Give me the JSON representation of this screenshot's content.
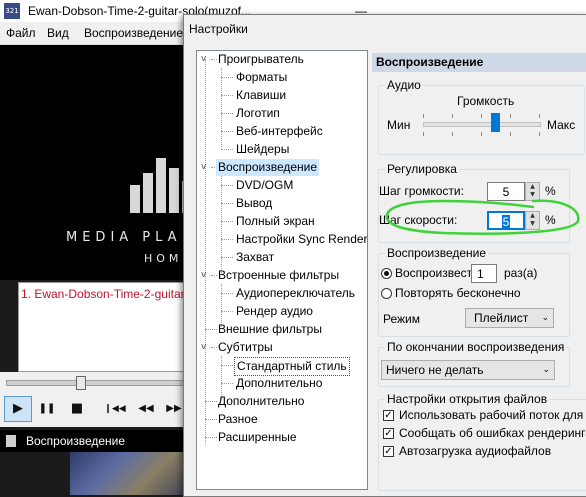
{
  "player": {
    "icon_label": "321",
    "title": "Ewan-Dobson-Time-2-guitar-solo(muzof...",
    "minimize_glyph": "—",
    "menu": [
      "Файл",
      "Вид",
      "Воспроизведение"
    ],
    "logo_text": "MEDIA PLA",
    "logo_sub": "HOME",
    "playlist_item": "1. Ewan-Dobson-Time-2-guitar-",
    "controls": {
      "play": "▶",
      "pause": "❚❚",
      "stop": "■",
      "prev": "❙◀◀",
      "rewind": "◀◀",
      "forward": "▶▶"
    },
    "status_text": "Воспроизведение"
  },
  "dialog": {
    "title": "Настройки",
    "tree": {
      "collapse_glyph": "v",
      "items": [
        "Проигрыватель",
        "Форматы",
        "Клавиши",
        "Логотип",
        "Веб-интерфейс",
        "Шейдеры",
        "Воспроизведение",
        "DVD/OGM",
        "Вывод",
        "Полный экран",
        "Настройки Sync Render",
        "Захват",
        "Встроенные фильтры",
        "Аудиопереключатель",
        "Рендер аудио",
        "Внешние фильтры",
        "Субтитры",
        "Стандартный стиль",
        "Дополнительно",
        "Дополнительно",
        "Разное",
        "Расширенные"
      ]
    },
    "panel": {
      "header": "Воспроизведение",
      "audio": {
        "group_label": "Аудио",
        "volume_label": "Громкость",
        "min_label": "Мин",
        "max_label": "Макс",
        "volume_level": 0.5
      },
      "regulation": {
        "group_label": "Регулировка",
        "volume_step_label": "Шаг громкости:",
        "volume_step_value": "5",
        "speed_step_label": "Шаг скорости:",
        "speed_step_value": "5",
        "unit": "%"
      },
      "playback": {
        "group_label": "Воспроизведение",
        "play_label": "Воспроизвест",
        "play_count": "1",
        "times_label": "раз(а)",
        "repeat_label": "Повторять бесконечно",
        "mode_label": "Режим",
        "mode_value": "Плейлист"
      },
      "after_playback": {
        "group_label": "По окончании воспроизведения",
        "value": "Ничего не делать"
      },
      "file_open": {
        "group_label": "Настройки открытия файлов",
        "options": [
          "Использовать рабочий поток для п",
          "Сообщать об ошибках рендеринга",
          "Автозагрузка аудиофайлов"
        ],
        "checkmark": "✓"
      },
      "dropdown_glyph": "⌄",
      "spin_up": "▲",
      "spin_down": "▼"
    }
  },
  "colors": {
    "annotation": "#3fd23a",
    "selection": "#cce8ff",
    "accent": "#0078d7",
    "playlist_text": "#c0142c"
  }
}
